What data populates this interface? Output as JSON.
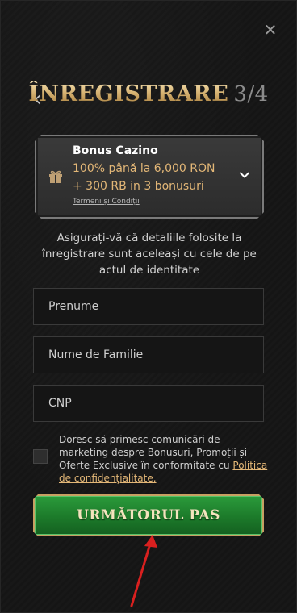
{
  "modal": {
    "close_icon": "close-icon",
    "back_icon": "chevron-left-icon"
  },
  "header": {
    "title": "ÎNREGISTRARE",
    "step": "3/4"
  },
  "bonus": {
    "icon": "gift-icon",
    "title": "Bonus Cazino",
    "line1": "100% până la 6,000 RON",
    "line2": "+ 300 RB in 3 bonusuri",
    "terms": "Termeni și Condiții",
    "expand_icon": "chevron-down-icon",
    "accent_color": "#e3b777"
  },
  "info_text": "Asigurați-vă că detaliile folosite la înregistrare sunt aceleași cu cele de pe actul de identitate",
  "form": {
    "first_name_placeholder": "Prenume",
    "last_name_placeholder": "Nume de Familie",
    "cnp_placeholder": "CNP"
  },
  "consent": {
    "text": "Doresc să primesc comunicări de marketing despre Bonusuri, Promoții și Oferte Exclusive în conformitate cu",
    "link": "Politica de confidențialitate."
  },
  "next_button": {
    "label": "URMĂTORUL PAS",
    "color": "#1c7a2a"
  },
  "annotation": {
    "arrow_icon": "red-arrow-icon",
    "color": "#d9201f"
  }
}
